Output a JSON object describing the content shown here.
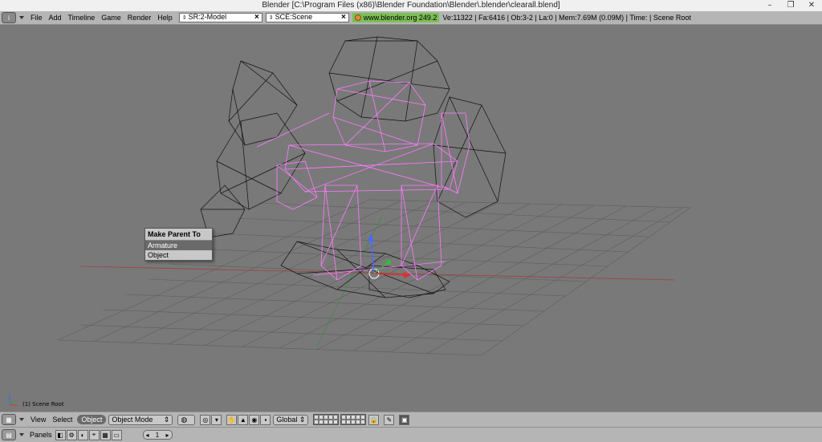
{
  "window": {
    "title": "Blender [C:\\Program Files (x86)\\Blender Foundation\\Blender\\.blender\\clearall.blend]",
    "minimize": "–",
    "restore": "❐",
    "close": "✕"
  },
  "menubar": {
    "items": [
      "File",
      "Add",
      "Timeline",
      "Game",
      "Render",
      "Help"
    ],
    "screen_field": "SR:2-Model",
    "scene_field": "SCE:Scene",
    "url": "www.blender.org 249.2",
    "stats": "Ve:11322 | Fa:6416 | Ob:3-2 | La:0  | Mem:7.69M (0.09M)  | Time: | Scene Root"
  },
  "popup": {
    "title": "Make Parent To",
    "items": [
      "Armature",
      "Object"
    ],
    "active_index": 0
  },
  "viewport": {
    "scene_label": "(1) Scene Root"
  },
  "header3d": {
    "view": "View",
    "select": "Select",
    "object": "Object",
    "mode": "Object Mode",
    "orientation": "Global"
  },
  "footer": {
    "panels": "Panels",
    "frame": "1"
  },
  "colors": {
    "viewport_bg": "#797979",
    "armature": "#ff7bff",
    "mesh_wire": "#000000",
    "menu_bg": "#b5b5b5",
    "url_bg": "#7bbf55"
  }
}
